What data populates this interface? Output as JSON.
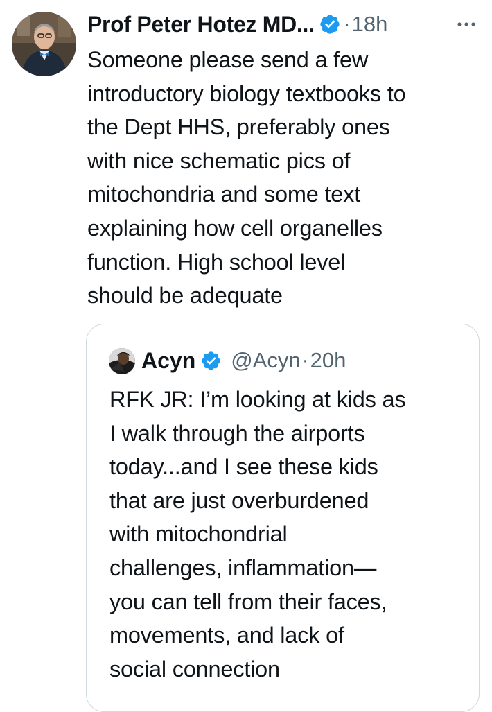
{
  "tweet": {
    "display_name": "Prof Peter Hotez MD...",
    "separator": "·",
    "time": "18h",
    "avatar_icon": "user-avatar-icon",
    "verified_icon": "verified-badge-icon",
    "more_icon": "more-options-icon",
    "body_lines": [
      "Someone please send a few",
      "introductory biology textbooks to",
      "the Dept HHS, preferably ones",
      "with nice schematic pics of",
      "mitochondria and some text",
      "explaining how cell organelles",
      "function. High school level",
      "should be adequate"
    ]
  },
  "quoted_tweet": {
    "display_name": "Acyn",
    "handle": "@Acyn",
    "separator": "·",
    "time": "20h",
    "avatar_icon": "user-avatar-icon",
    "verified_icon": "verified-badge-icon",
    "body_lines": [
      "RFK JR: I’m looking at kids as",
      "I walk through the airports",
      "today...and I see these kids",
      "that are just overburdened",
      "with mitochondrial",
      "challenges, inflammation—",
      "you can tell from their faces,",
      "movements, and lack of",
      "social connection"
    ]
  },
  "colors": {
    "text_primary": "#0f1419",
    "text_secondary": "#536471",
    "verified_blue": "#1d9bf0",
    "border": "#cfd9de"
  }
}
